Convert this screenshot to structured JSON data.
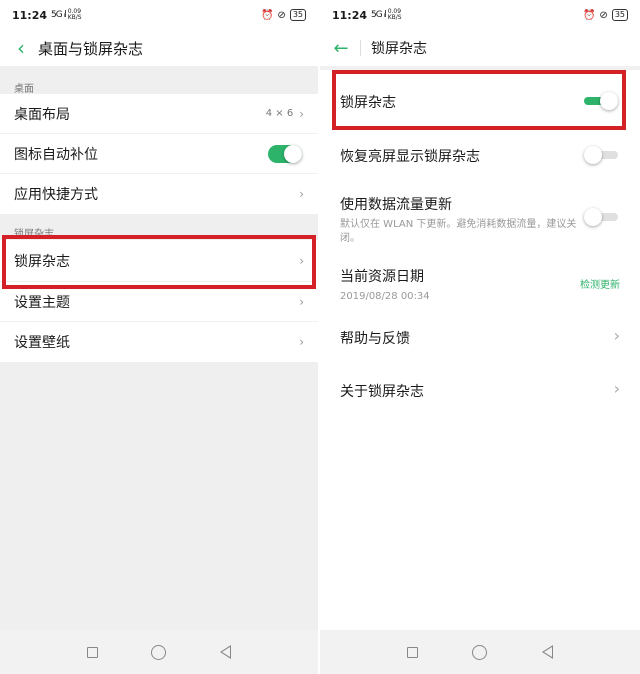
{
  "status_bar": {
    "time": "11:24",
    "signal": "5G ᵢl",
    "speed": "0.09 KB/S",
    "battery": "35"
  },
  "left": {
    "header": {
      "title": "桌面与锁屏杂志"
    },
    "section_desktop": "桌面",
    "desktop_items": [
      {
        "label": "桌面布局",
        "value": "4 × 6"
      },
      {
        "label": "图标自动补位"
      },
      {
        "label": "应用快捷方式"
      }
    ],
    "section_lock": "锁屏杂志",
    "lock_items": [
      {
        "label": "锁屏杂志"
      },
      {
        "label": "设置主题"
      },
      {
        "label": "设置壁纸"
      }
    ]
  },
  "right": {
    "header": {
      "title": "锁屏杂志"
    },
    "items": [
      {
        "title": "锁屏杂志"
      },
      {
        "title": "恢复亮屏显示锁屏杂志"
      },
      {
        "title": "使用数据流量更新",
        "subtitle": "默认仅在 WLAN 下更新。避免消耗数据流量，建议关闭。"
      },
      {
        "title": "当前资源日期",
        "subtitle": "2019/08/28 00:34",
        "action": "检测更新"
      },
      {
        "title": "帮助与反馈"
      },
      {
        "title": "关于锁屏杂志"
      }
    ]
  },
  "toggles": {
    "icon_autofill": true,
    "lock_magazine": true,
    "wake_display": false,
    "mobile_data": false
  },
  "colors": {
    "accent": "#2db36a",
    "highlight": "#d42027"
  },
  "icons": [
    "back-arrow-icon",
    "chevron-right-icon",
    "nav-square-icon",
    "nav-circle-icon",
    "nav-back-icon"
  ]
}
